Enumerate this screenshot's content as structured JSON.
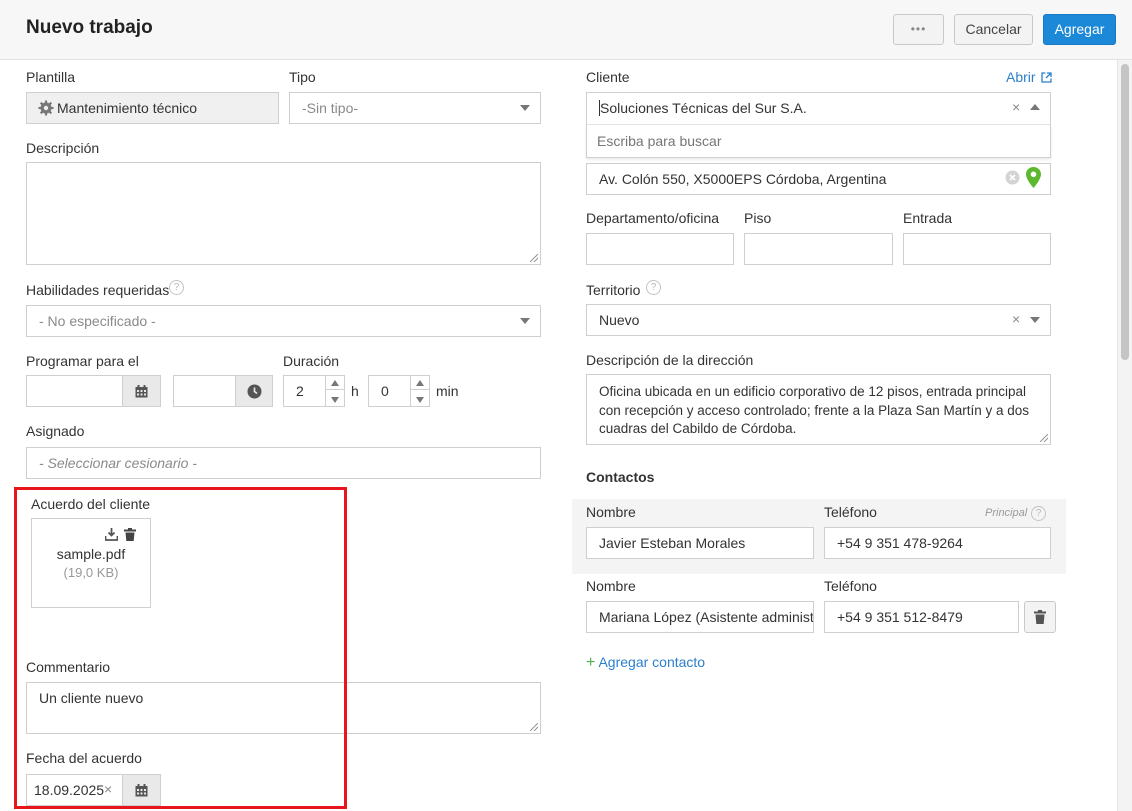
{
  "header": {
    "title": "Nuevo trabajo",
    "more_label": "•••",
    "cancel_label": "Cancelar",
    "add_label": "Agregar"
  },
  "left": {
    "template": {
      "label": "Plantilla",
      "value": "Mantenimiento técnico",
      "icon": "gear-icon"
    },
    "type": {
      "label": "Tipo",
      "value": "-Sin tipo-"
    },
    "description": {
      "label": "Descripción",
      "value": ""
    },
    "skills": {
      "label": "Habilidades requeridas",
      "help": "?",
      "value": "- No especificado -"
    },
    "schedule": {
      "label": "Programar para el",
      "date_value": "",
      "time_value": "",
      "calendar_icon": "calendar-icon",
      "clock_icon": "clock-icon"
    },
    "duration": {
      "label": "Duración",
      "hours": "2",
      "hours_unit": "h",
      "minutes": "0",
      "minutes_unit": "min"
    },
    "assigned": {
      "label": "Asignado",
      "value": "- Seleccionar cesionario -"
    },
    "agreement": {
      "label": "Acuerdo del cliente",
      "file_name": "sample.pdf",
      "file_size": "(19,0 KB)",
      "download_icon": "download-icon",
      "delete_icon": "trash-icon"
    },
    "comment": {
      "label": "Commentario",
      "value": "Un cliente nuevo"
    },
    "agreement_date": {
      "label": "Fecha del acuerdo",
      "value": "18.09.2025",
      "clear": "×"
    }
  },
  "right": {
    "client": {
      "label": "Cliente",
      "open_link": "Abrir",
      "value": "Soluciones Técnicas del Sur S.A.",
      "search_placeholder": "Escriba para buscar",
      "clear": "×"
    },
    "address": {
      "value": "Av. Colón 550, X5000EPS Córdoba, Argentina",
      "pin_color": "#5cb82e"
    },
    "department": {
      "label": "Departamento/oficina",
      "value": ""
    },
    "floor": {
      "label": "Piso",
      "value": ""
    },
    "entrance": {
      "label": "Entrada",
      "value": ""
    },
    "territory": {
      "label": "Territorio",
      "help": "?",
      "value": "Nuevo",
      "clear": "×"
    },
    "address_description": {
      "label": "Descripción de la dirección",
      "value": "Oficina ubicada en un edificio corporativo de 12 pisos, entrada principal con recepción y acceso controlado; frente a la Plaza San Martín y a dos cuadras del Cabildo de Córdoba."
    },
    "contacts": {
      "title": "Contactos",
      "primary_label": "Principal",
      "help": "?",
      "items": [
        {
          "name_label": "Nombre",
          "name": "Javier Esteban Morales",
          "phone_label": "Teléfono",
          "phone": "+54 9 351 478-9264"
        },
        {
          "name_label": "Nombre",
          "name": "Mariana López (Asistente administrativa)",
          "phone_label": "Teléfono",
          "phone": "+54 9 351 512-8479"
        }
      ],
      "add_label": "Agregar contacto"
    }
  },
  "colors": {
    "accent": "#1c88d8",
    "link": "#2b7fcb",
    "highlight_border": "#e8161c",
    "add_contact_plus": "#4caf50"
  }
}
